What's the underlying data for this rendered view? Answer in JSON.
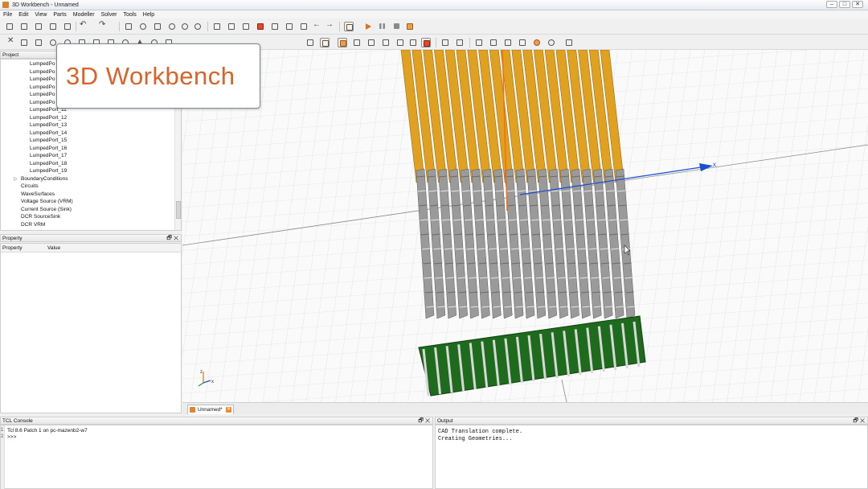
{
  "window": {
    "title": "3D Workbench - Unnamed",
    "controls": [
      "–",
      "□",
      "✕"
    ]
  },
  "menu": [
    "File",
    "Edit",
    "View",
    "Parts",
    "Modeller",
    "Solver",
    "Tools",
    "Help"
  ],
  "project_panel": {
    "title": "Project",
    "items": [
      "LumpedPo",
      "LumpedPo",
      "LumpedPo",
      "LumpedPo",
      "LumpedPo",
      "LumpedPo",
      "LumpedPort_11",
      "LumpedPort_12",
      "LumpedPort_13",
      "LumpedPort_14",
      "LumpedPort_15",
      "LumpedPort_16",
      "LumpedPort_17",
      "LumpedPort_18",
      "LumpedPort_19",
      "BoundaryConditions",
      "Circuits",
      "WaveSurfaces",
      "Voltage Source (VRM)",
      "Current Source (Sink)",
      "DCR SourceSink",
      "DCR VRM"
    ]
  },
  "property_panel": {
    "title": "Property",
    "columns": [
      "Property",
      "Value"
    ]
  },
  "panel_controls": "🗗 ✕",
  "callout": {
    "text": "3D Workbench"
  },
  "viewport": {
    "axis_x_label": "x",
    "triad_z": "z",
    "triad_x": "x",
    "colors": {
      "pins_gold": "#e0a020",
      "pins_gray": "#9a9a9a",
      "board_green": "#1e6b1e",
      "axis_blue": "#1a4fd0",
      "axis_orange": "#ff6a00"
    }
  },
  "document_tab": {
    "label": "Unnamed*",
    "close": "✕"
  },
  "tcl_console": {
    "title": "TCL Console",
    "lines": [
      "Tcl 8.6 Patch 1 on pc-mazenb2-w7",
      ">>>"
    ],
    "line_numbers": [
      "1",
      "2"
    ]
  },
  "output_panel": {
    "title": "Output",
    "lines": [
      "CAD Translation complete.",
      "Creating Geometries..."
    ]
  }
}
